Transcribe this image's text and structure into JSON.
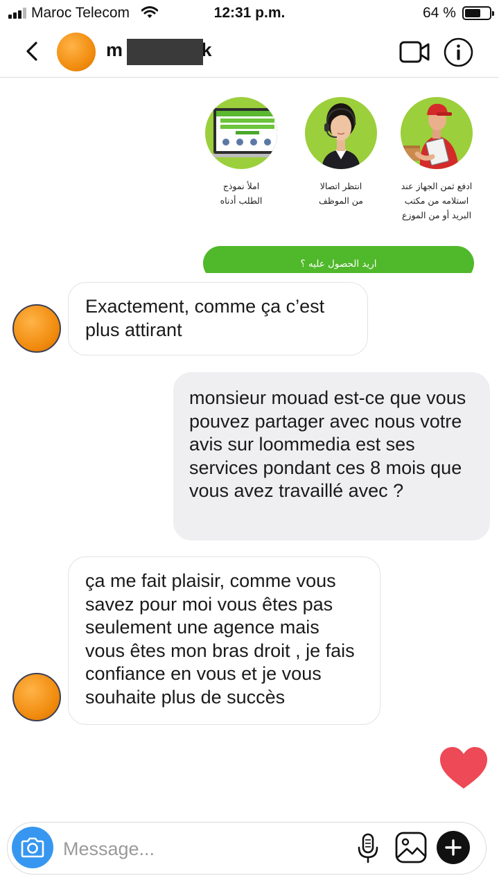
{
  "status_bar": {
    "carrier": "Maroc Telecom",
    "time": "12:31 p.m.",
    "battery_percent": "64 %",
    "battery_level": 0.64,
    "signal_bars": 3
  },
  "header": {
    "username_start": "m",
    "username_end": "rk"
  },
  "shared_image": {
    "step1": [
      "املأ نموذج",
      "الطلب أدناه"
    ],
    "step2": [
      "انتظر اتصالا",
      "من الموظف"
    ],
    "step3": [
      "ادفع ثمن الجهاز عند",
      "استلامه من مكتب",
      "البريد أو من الموزع"
    ],
    "button_label": "اريد الحصول عليه ؟"
  },
  "messages": [
    {
      "direction": "in",
      "text": "Exactement, comme ça c’est plus attirant"
    },
    {
      "direction": "out",
      "text": "monsieur mouad est-ce que vous pouvez partager avec nous votre avis sur loommedia est ses services pondant ces 8 mois que vous avez travaillé avec ?"
    },
    {
      "direction": "in",
      "text": "ça me fait plaisir, comme vous savez pour moi vous êtes pas seulement une agence mais vous êtes mon bras droit , je fais confiance en vous et je vous souhaite plus de succès"
    }
  ],
  "composer": {
    "placeholder": "Message..."
  },
  "colors": {
    "accent_blue": "#3797f0",
    "heart_red": "#ed4956",
    "cta_green": "#50b82b",
    "avatar_orange": "#f08a0c",
    "outgoing_bubble": "#efeff2"
  },
  "icons": [
    "back-chevron-icon",
    "video-call-icon",
    "info-icon",
    "heart-icon",
    "camera-icon",
    "microphone-icon",
    "gallery-icon",
    "plus-icon"
  ]
}
